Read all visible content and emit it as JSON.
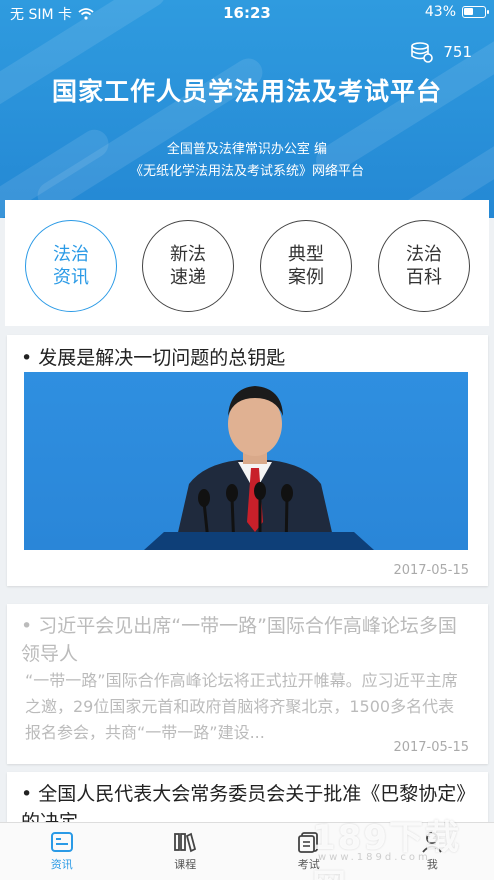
{
  "status_bar": {
    "carrier": "无 SIM 卡",
    "time": "16:23",
    "battery": "43%",
    "battery_level": 0.43
  },
  "header": {
    "coins": "751",
    "title": "国家工作人员学法用法及考试平台",
    "subtitle_line1": "全国普及法律常识办公室 编",
    "subtitle_line2": "《无纸化学法用法及考试系统》网络平台"
  },
  "categories": [
    {
      "line1": "法治",
      "line2": "资讯",
      "active": true
    },
    {
      "line1": "新法",
      "line2": "速递",
      "active": false
    },
    {
      "line1": "典型",
      "line2": "案例",
      "active": false
    },
    {
      "line1": "法治",
      "line2": "百科",
      "active": false
    }
  ],
  "news": [
    {
      "title": "• 发展是解决一切问题的总钥匙",
      "date": "2017-05-15"
    },
    {
      "title": "• 习近平会见出席“一带一路”国际合作高峰论坛多国领导人",
      "desc": "“一带一路”国际合作高峰论坛将正式拉开帷幕。应习近平主席之邀，29位国家元首和政府首脑将齐聚北京，1500多名代表报名参会，共商“一带一路”建设...",
      "date": "2017-05-15"
    },
    {
      "title": "• 全国人民代表大会常务委员会关于批准《巴黎协定》的决定"
    }
  ],
  "tabbar": [
    {
      "label": "资讯",
      "icon": "news-icon",
      "active": true
    },
    {
      "label": "课程",
      "icon": "books-icon",
      "active": false
    },
    {
      "label": "考试",
      "icon": "exam-icon",
      "active": false
    },
    {
      "label": "我",
      "icon": "person-icon",
      "active": false
    }
  ],
  "watermark": {
    "main": "189下载网",
    "sub": "www.189d.com"
  },
  "colors": {
    "primary": "#2a9ae6",
    "header": "#2488d4"
  }
}
